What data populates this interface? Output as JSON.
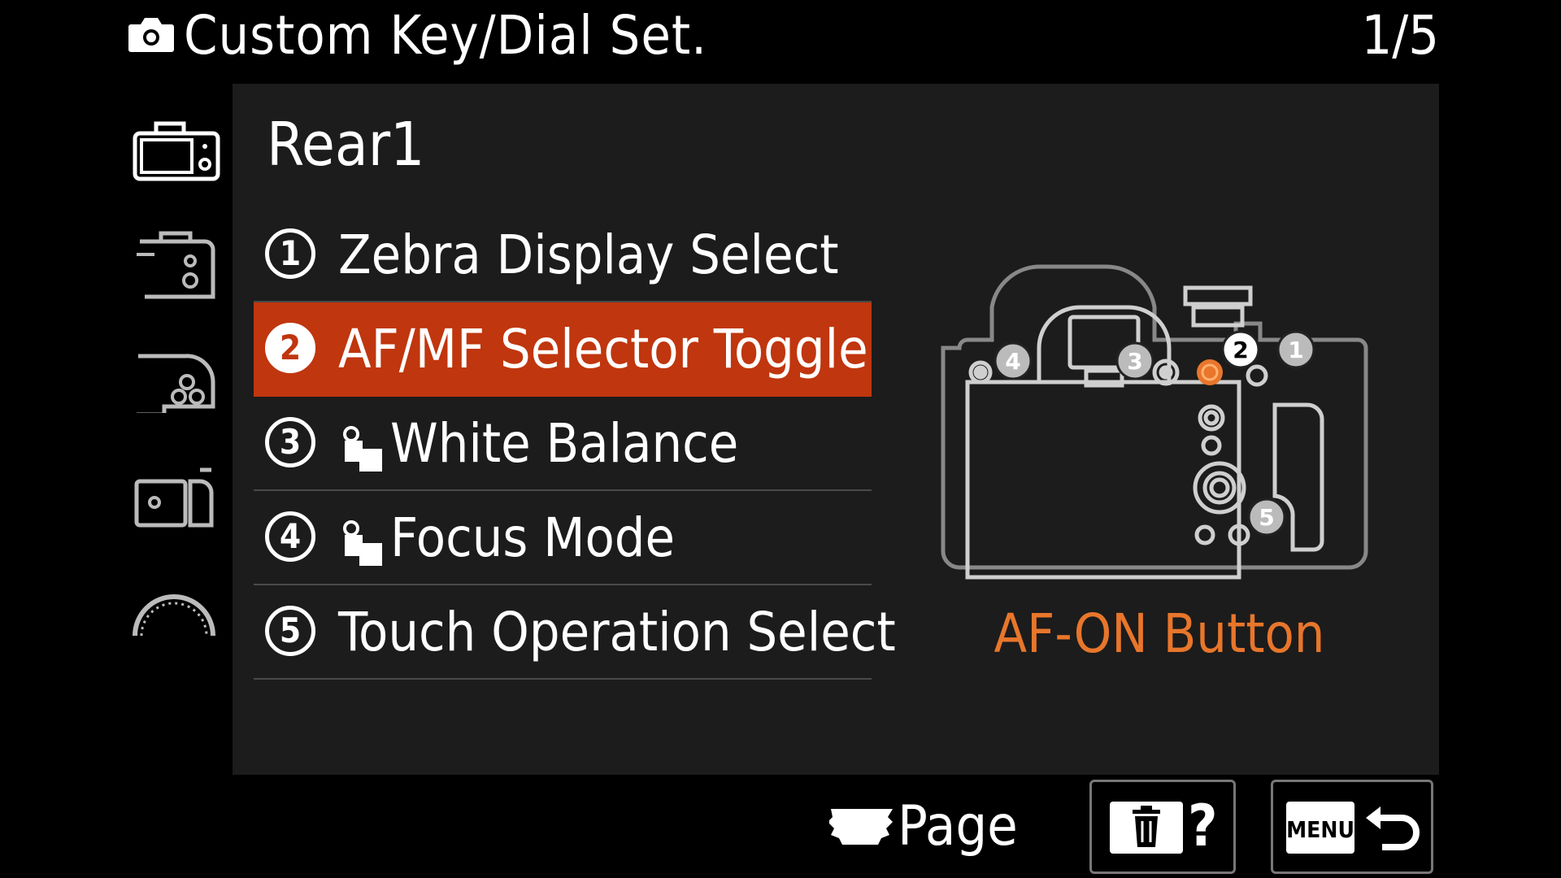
{
  "header": {
    "title": "Custom Key/Dial Set.",
    "page_indicator": "1/5"
  },
  "sidebar": {
    "tabs": [
      {
        "icon": "camera-body-rear-icon",
        "active": true
      },
      {
        "icon": "camera-top-right-icon",
        "active": false
      },
      {
        "icon": "camera-dial-icon",
        "active": false
      },
      {
        "icon": "camera-side-icon",
        "active": false
      },
      {
        "icon": "dial-scale-icon",
        "active": false
      }
    ]
  },
  "panel": {
    "subtitle": "Rear1",
    "items": [
      {
        "number": "1",
        "label": "Zebra Display Select",
        "lock": false,
        "selected": false
      },
      {
        "number": "2",
        "label": "AF/MF Selector Toggle",
        "lock": false,
        "selected": true
      },
      {
        "number": "3",
        "label": "White Balance",
        "lock": true,
        "selected": false
      },
      {
        "number": "4",
        "label": "Focus Mode",
        "lock": true,
        "selected": false
      },
      {
        "number": "5",
        "label": "Touch Operation Select",
        "lock": false,
        "selected": false
      }
    ],
    "diagram_markers": [
      "1",
      "2",
      "3",
      "4",
      "5"
    ],
    "button_name": "AF-ON Button"
  },
  "footer": {
    "page_label": "Page",
    "delete_help_label": "?",
    "menu_label": "MENU"
  },
  "colors": {
    "selected_bg": "#c0360e",
    "accent_orange": "#e8762b",
    "panel_bg": "#1c1c1c"
  }
}
